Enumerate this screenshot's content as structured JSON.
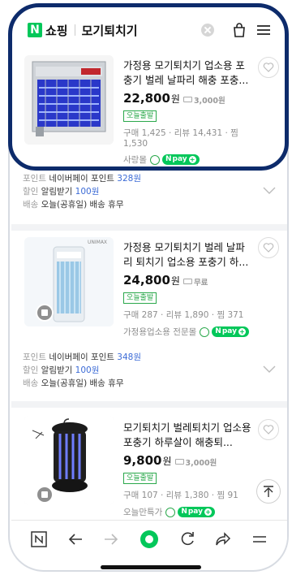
{
  "search": {
    "logo_letter": "N",
    "service": "쇼핑",
    "query": "모기퇴치기"
  },
  "products": [
    {
      "title": "가정용 모기퇴치기 업소용 포충기 벌레 날파리 해충 포충...",
      "price": "22,800",
      "won": "원",
      "shipping": "3,000원",
      "badge": "오늘출발",
      "meta": "구매 1,425 · 리뷰 14,431 · 찜 1,530",
      "seller": "사랑몰",
      "pay": "pay"
    },
    {
      "title": "가정용 모기퇴치기 벌레 날파리 퇴치기 업소용 포충기 하...",
      "price": "24,800",
      "won": "원",
      "shipping": "무료",
      "badge": "오늘출발",
      "meta": "구매 287 · 리뷰 1,890 · 찜 371",
      "seller": "가정용업소용 전문몰",
      "pay": "pay",
      "brand_mark": "UNIMAX"
    },
    {
      "title": "모기퇴치기 벌레퇴치기 업소용 포충기 하루살이 해충퇴...",
      "price": "9,800",
      "won": "원",
      "shipping": "3,000원",
      "badge": "오늘출발",
      "meta": "구매 107 · 리뷰 1,380 · 찜 91",
      "seller": "오늘만특가",
      "pay": "pay"
    }
  ],
  "benefits": [
    {
      "point_label": "포인트",
      "point_text": "네이버페이 포인트",
      "point_value": "328원",
      "discount_label": "할인",
      "discount_text": "알림받기",
      "discount_value": "100원",
      "delivery_label": "배송",
      "delivery_text": "오늘(공휴일) 배송 휴무"
    },
    {
      "point_label": "포인트",
      "point_text": "네이버페이 포인트",
      "point_value": "348원",
      "discount_label": "할인",
      "discount_text": "알림받기",
      "discount_value": "100원",
      "delivery_label": "배송",
      "delivery_text": "오늘(공휴일) 배송 휴무"
    }
  ],
  "colors": {
    "naver_green": "#03c75a",
    "highlight_border": "#0d2b6b",
    "link_blue": "#3c6bd6"
  }
}
